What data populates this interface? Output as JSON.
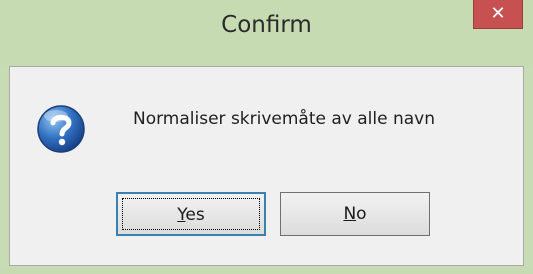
{
  "window": {
    "title": "Confirm",
    "close_glyph": "✕"
  },
  "dialog": {
    "icon": "question-icon",
    "message": "Normaliser skrivemåte av alle navn"
  },
  "buttons": {
    "yes": {
      "mnemonic": "Y",
      "rest": "es"
    },
    "no": {
      "mnemonic": "N",
      "rest": "o"
    }
  },
  "colors": {
    "frame": "#c6dbb2",
    "close": "#c75050",
    "client": "#f0f0f0",
    "focus_border": "#3c7fb1"
  }
}
